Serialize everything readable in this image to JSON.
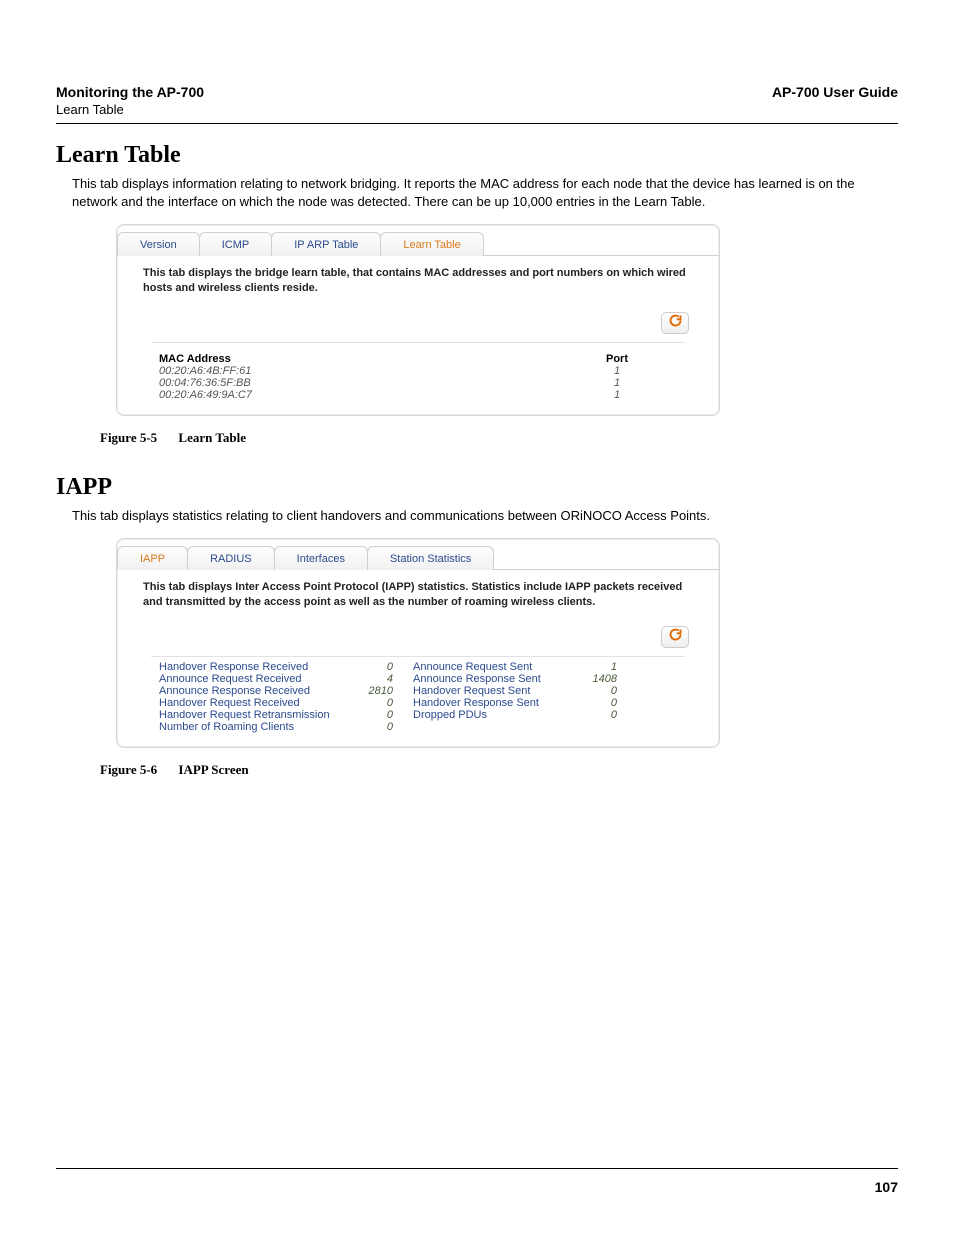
{
  "header": {
    "left_title": "Monitoring the AP-700",
    "left_sub": "Learn Table",
    "right_title": "AP-700 User Guide"
  },
  "sections": {
    "learn": {
      "heading": "Learn Table",
      "paragraph": "This tab displays information relating to network bridging. It reports the MAC address for each node that the device has learned is on the network and the interface on which the node was detected. There can be up 10,000 entries in the Learn Table.",
      "caption_no": "Figure 5-5",
      "caption_txt": "Learn Table"
    },
    "iapp": {
      "heading": "IAPP",
      "paragraph": "This tab displays statistics relating to client handovers and communications between ORiNOCO Access Points.",
      "caption_no": "Figure 5-6",
      "caption_txt": "IAPP Screen"
    }
  },
  "panel1": {
    "tabs": [
      "Version",
      "ICMP",
      "IP ARP Table",
      "Learn Table"
    ],
    "active": 3,
    "desc": "This tab displays the bridge learn table, that contains MAC addresses and port numbers on which wired hosts and wireless clients reside.",
    "col_mac": "MAC Address",
    "col_port": "Port",
    "rows": [
      {
        "mac": "00:20:A6:4B:FF:61",
        "port": "1"
      },
      {
        "mac": "00:04:76:36:5F:BB",
        "port": "1"
      },
      {
        "mac": "00:20:A6:49:9A:C7",
        "port": "1"
      }
    ]
  },
  "panel2": {
    "tabs": [
      "IAPP",
      "RADIUS",
      "Interfaces",
      "Station Statistics"
    ],
    "active": 0,
    "desc": "This tab displays Inter Access Point Protocol (IAPP) statistics. Statistics include IAPP packets received and transmitted by the access point as well as the number of roaming wireless clients.",
    "left": [
      {
        "label": "Handover Response Received",
        "val": "0"
      },
      {
        "label": "Announce Request Received",
        "val": "4"
      },
      {
        "label": "Announce Response Received",
        "val": "2810"
      },
      {
        "label": "Handover Request Received",
        "val": "0"
      },
      {
        "label": "Handover Request Retransmission",
        "val": "0"
      },
      {
        "label": "Number of Roaming Clients",
        "val": "0"
      }
    ],
    "right": [
      {
        "label": "Announce Request Sent",
        "val": "1"
      },
      {
        "label": "Announce Response Sent",
        "val": "1408"
      },
      {
        "label": "Handover Request Sent",
        "val": "0"
      },
      {
        "label": "Handover Response Sent",
        "val": "0"
      },
      {
        "label": "Dropped PDUs",
        "val": "0"
      }
    ]
  },
  "page_number": "107"
}
